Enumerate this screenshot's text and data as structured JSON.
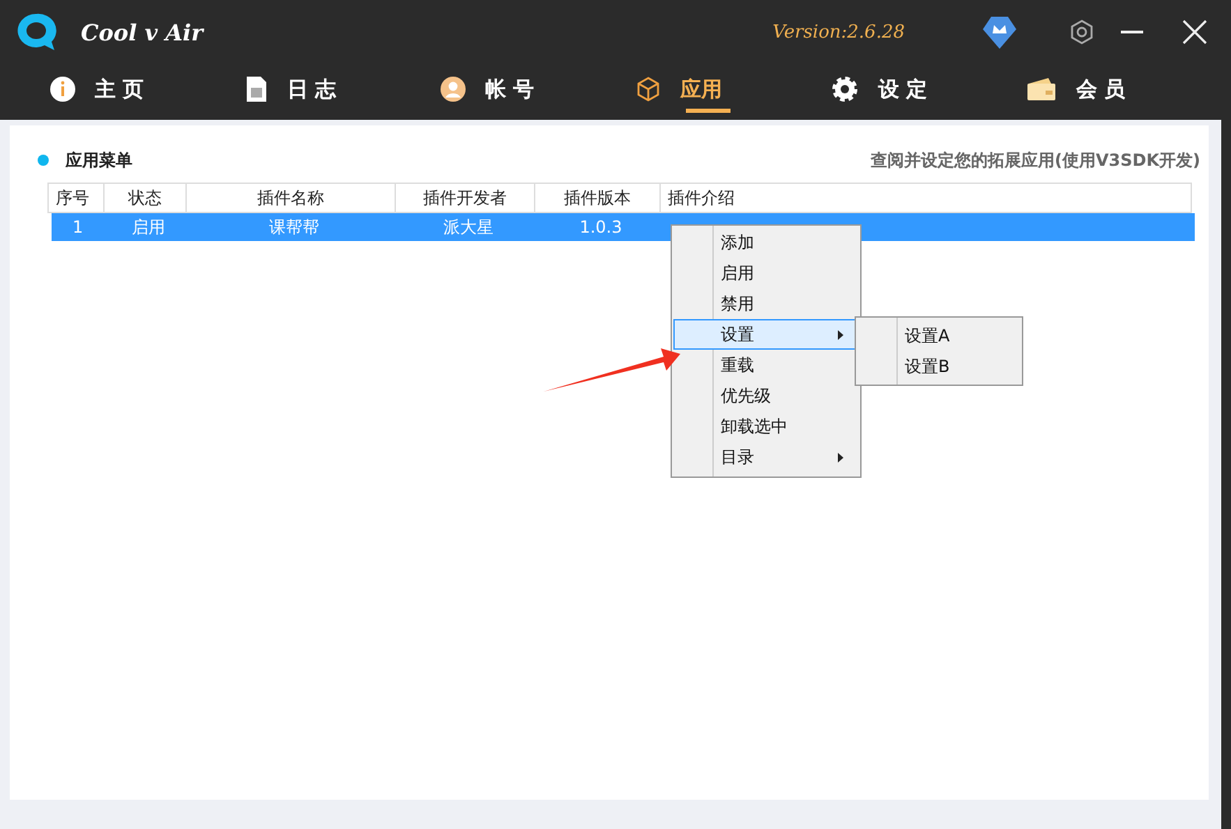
{
  "window": {
    "title": "Cool v Air",
    "version": "Version:2.6.28"
  },
  "nav_tabs": [
    {
      "label": "主 页",
      "kind": "info",
      "selected": false
    },
    {
      "label": "日 志",
      "kind": "doc",
      "selected": false
    },
    {
      "label": "帐 号",
      "kind": "user",
      "selected": false
    },
    {
      "label": "应用",
      "kind": "cube",
      "selected": true
    },
    {
      "label": "设 定",
      "kind": "gear",
      "selected": false
    },
    {
      "label": "会 员",
      "kind": "wallet",
      "selected": false
    }
  ],
  "panel": {
    "title": "应用菜单",
    "hint": "查阅并设定您的拓展应用(使用V3SDK开发)"
  },
  "table": {
    "columns": [
      "序号",
      "状态",
      "插件名称",
      "插件开发者",
      "插件版本",
      "插件介绍"
    ],
    "rows": [
      {
        "cells": [
          "1",
          "启用",
          "课帮帮",
          "派大星",
          "1.0.3"
        ],
        "selected": true
      }
    ]
  },
  "context_menu": {
    "items": [
      {
        "label": "添加",
        "submenu": false,
        "highlighted": false
      },
      {
        "label": "启用",
        "submenu": false,
        "highlighted": false
      },
      {
        "label": "禁用",
        "submenu": false,
        "highlighted": false
      },
      {
        "label": "设置",
        "submenu": true,
        "highlighted": true
      },
      {
        "label": "重载",
        "submenu": false,
        "highlighted": false
      },
      {
        "label": "优先级",
        "submenu": false,
        "highlighted": false
      },
      {
        "label": "卸载选中",
        "submenu": false,
        "highlighted": false
      },
      {
        "label": "目录",
        "submenu": true,
        "highlighted": false
      }
    ],
    "submenu": [
      "设置A",
      "设置B"
    ]
  }
}
